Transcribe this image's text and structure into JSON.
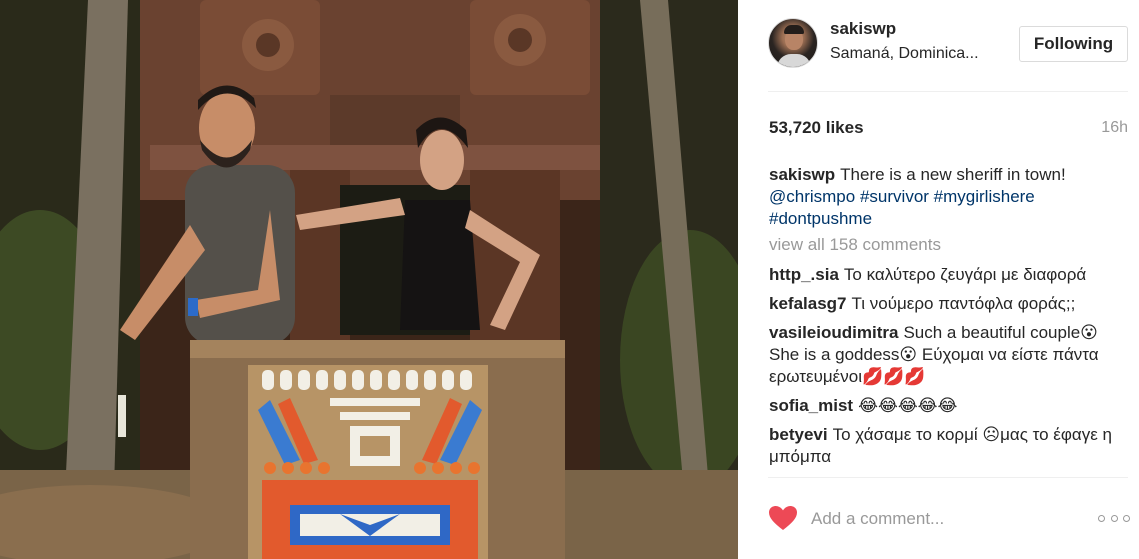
{
  "post": {
    "username": "sakiswp",
    "location": "Samaná, Dominica...",
    "follow_label": "Following",
    "likes": "53,720 likes",
    "time": "16h",
    "caption": {
      "text": "There is a new sheriff in town!",
      "tags": [
        "@chrismpo",
        "#survivor",
        "#mygirlishere",
        "#dontpushme"
      ]
    },
    "view_all": "view all 158 comments",
    "add_comment_placeholder": "Add a comment...",
    "like_color": "#ed4956"
  },
  "comments": [
    {
      "user": "http_.sia",
      "text": "Το καλύτερο ζευγάρι με διαφορά"
    },
    {
      "user": "kefalasg7",
      "text": "Τι νούμερο παντόφλα φοράς;;"
    },
    {
      "user": "vasileioudimitra",
      "text": "Such a beautiful couple😮 She is a goddess😮 Εύχομαι να είστε πάντα ερωτευμένοι💋💋💋"
    },
    {
      "user": "sofia_mist",
      "text": "😂😂😂😂😂"
    },
    {
      "user": "betyevi",
      "text": "Το χάσαμε το κορμί ☹μας το έφαγε η μπόμπα"
    }
  ]
}
